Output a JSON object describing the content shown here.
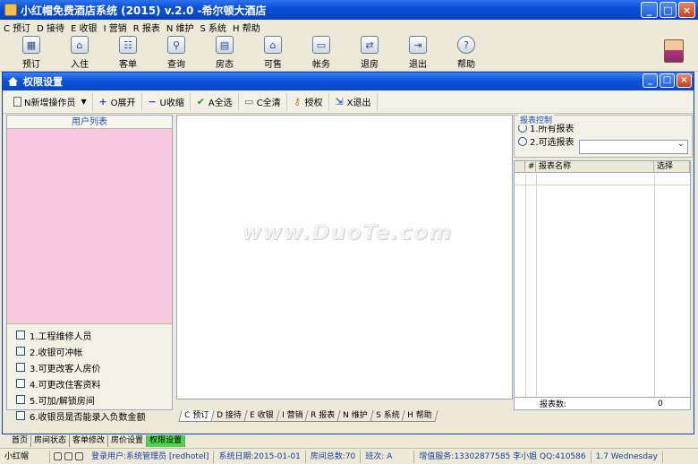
{
  "window": {
    "title": "小红帽免费酒店系统 (2015) v.2.0 -希尔顿大酒店"
  },
  "menu": [
    "C 预订",
    "D 接待",
    "E 收银",
    "I 营销",
    "R 报表",
    "N 维护",
    "S 系统",
    "H 帮助"
  ],
  "toolbar": [
    {
      "label": "预订",
      "icon": "calendar-icon"
    },
    {
      "label": "入住",
      "icon": "checkin-icon"
    },
    {
      "label": "客单",
      "icon": "guest-list-icon"
    },
    {
      "label": "查询",
      "icon": "search-icon"
    },
    {
      "label": "房态",
      "icon": "room-grid-icon"
    },
    {
      "label": "可售",
      "icon": "available-rooms-icon"
    },
    {
      "label": "帐务",
      "icon": "accounts-icon"
    },
    {
      "label": "退房",
      "icon": "checkout-icon"
    },
    {
      "label": "退出",
      "icon": "exit-icon"
    },
    {
      "label": "帮助",
      "icon": "help-icon"
    }
  ],
  "inner": {
    "title": "权限设置",
    "buttons": [
      {
        "label": "N新增操作员",
        "icon": "new-document-icon"
      },
      {
        "label": "O展开",
        "icon": "plus-icon"
      },
      {
        "label": "U收缩",
        "icon": "minus-icon"
      },
      {
        "label": "A全选",
        "icon": "check-icon"
      },
      {
        "label": "C全清",
        "icon": "eraser-icon"
      },
      {
        "label": "授权",
        "icon": "key-icon"
      },
      {
        "label": "X退出",
        "icon": "exit-door-icon"
      }
    ]
  },
  "left": {
    "header": "用户列表",
    "permissions": [
      "1.工程维修人员",
      "2.收银可冲帐",
      "3.可更改客人房价",
      "4.可更改住客资料",
      "5.可加/解锁房间",
      "6.收银员是否能录入负数金额"
    ]
  },
  "watermark": "www.DuoTe.com",
  "center_tabs": [
    "C 预订",
    "D 接待",
    "E 收银",
    "I 营销",
    "R 报表",
    "N 维护",
    "S 系统",
    "H 帮助"
  ],
  "right": {
    "group_title": "报表控制",
    "radio1": "1.所有报表",
    "radio2": "2.可选报表",
    "grid_headers": [
      "#",
      "报表名称",
      "选择"
    ],
    "footer_label": "报表数:",
    "footer_value": "0"
  },
  "window_tabs": [
    "首页",
    "房间状态",
    "客单修改",
    "房价设置",
    "权限设置"
  ],
  "status": {
    "user_short": "小红帽",
    "login": "登录用户:系统管理员 [redhotel]",
    "system_date": "系统日期:2015-01-01",
    "room_total": "房间总数:70",
    "shift": "班次: A",
    "service": "增值服务:13302877585 李小姐 QQ:410586",
    "extra": "1.7 Wednesday"
  },
  "colors": {
    "title_blue": "#0a4fd9",
    "user_list_bg": "#f9c9e0",
    "active_tab": "#4bd64b"
  }
}
